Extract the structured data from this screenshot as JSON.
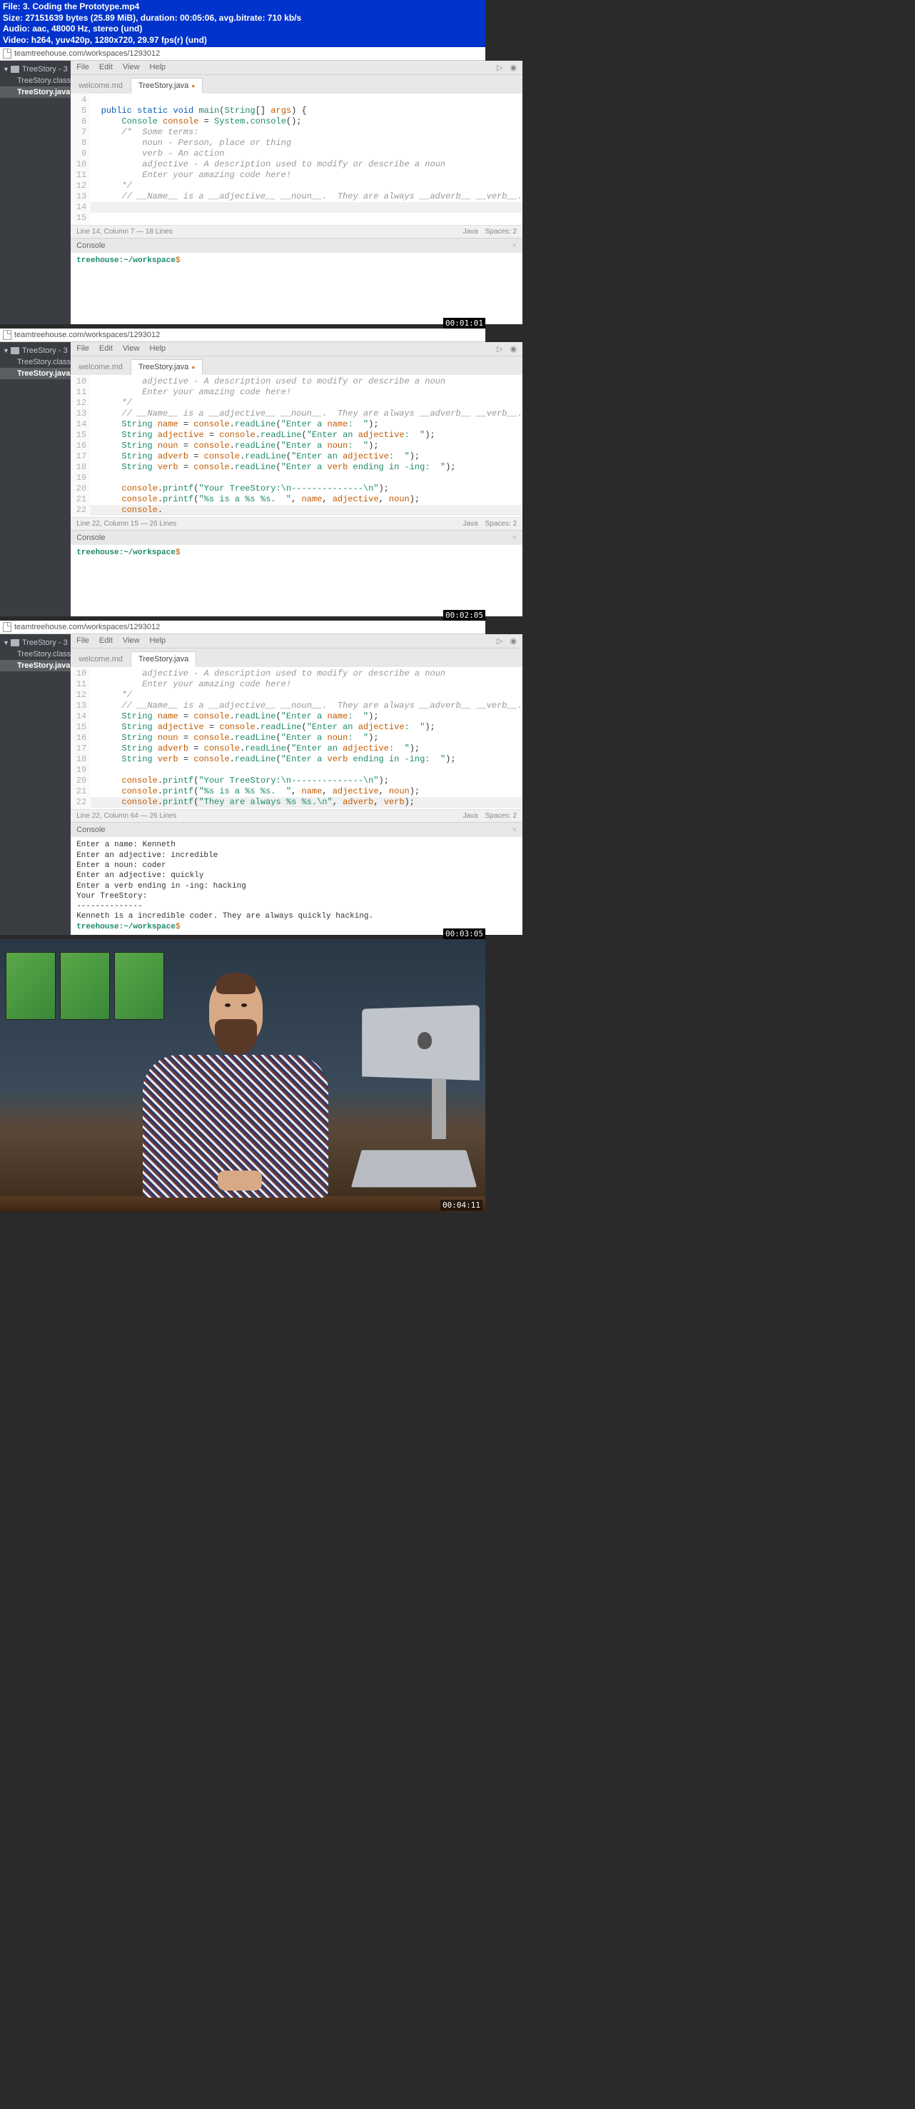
{
  "header": {
    "line1": "File: 3. Coding the Prototype.mp4",
    "line2": "Size: 27151639 bytes (25.89 MiB), duration: 00:05:06, avg.bitrate: 710 kb/s",
    "line3": "Audio: aac, 48000 Hz, stereo (und)",
    "line4": "Video: h264, yuv420p, 1280x720, 29.97 fps(r) (und)"
  },
  "url": "teamtreehouse.com/workspaces/1293012",
  "sidebar": {
    "project": "TreeStory - 3",
    "items": [
      "TreeStory.class",
      "TreeStory.java"
    ],
    "active": "TreeStory.java"
  },
  "menu": {
    "items": [
      "File",
      "Edit",
      "View",
      "Help"
    ]
  },
  "tabs": {
    "inactive": "welcome.md",
    "active": "TreeStory.java"
  },
  "status": {
    "lang": "Java",
    "spaces": "Spaces: 2"
  },
  "console": {
    "title": "Console",
    "prompt_host": "treehouse:~/workspace",
    "prompt_sym": "$"
  },
  "block1": {
    "gutter": [
      "4",
      "5",
      "6",
      "7",
      "8",
      "9",
      "10",
      "11",
      "12",
      "13",
      "14",
      "15"
    ],
    "code": [
      "",
      "  public static void main(String[] args) {",
      "      Console console = System.console();",
      "      /*  Some terms:",
      "          noun - Person, place or thing",
      "          verb - An action",
      "          adjective - A description used to modify or describe a noun",
      "          Enter your amazing code here!",
      "      */",
      "      // __Name__ is a __adjective__ __noun__.  They are always __adverb__ __verb__.",
      "      ",
      ""
    ],
    "status": "Line 14, Column 7 — 18 Lines",
    "timestamp": "00:01:01"
  },
  "block2": {
    "gutter": [
      "10",
      "11",
      "12",
      "13",
      "14",
      "15",
      "16",
      "17",
      "18",
      "19",
      "20",
      "21",
      "22"
    ],
    "code_raw": [
      "          adjective - A description used to modify or describe a noun",
      "          Enter your amazing code here!",
      "      */",
      "      // __Name__ is a __adjective__ __noun__.  They are always __adverb__ __verb__.",
      "      String name = console.readLine(\"Enter a name:  \");",
      "      String adjective = console.readLine(\"Enter an adjective:  \");",
      "      String noun = console.readLine(\"Enter a noun:  \");",
      "      String adverb = console.readLine(\"Enter an adjective:  \");",
      "      String verb = console.readLine(\"Enter a verb ending in -ing:  \");",
      "",
      "      console.printf(\"Your TreeStory:\\n--------------\\n\");",
      "      console.printf(\"%s is a %s %s.  \", name, adjective, noun);",
      "      console."
    ],
    "status": "Line 22, Column 15 — 26 Lines",
    "timestamp": "00:02:05"
  },
  "block3": {
    "gutter": [
      "10",
      "11",
      "12",
      "13",
      "14",
      "15",
      "16",
      "17",
      "18",
      "19",
      "20",
      "21",
      "22"
    ],
    "code_raw": [
      "          adjective - A description used to modify or describe a noun",
      "          Enter your amazing code here!",
      "      */",
      "      // __Name__ is a __adjective__ __noun__.  They are always __adverb__ __verb__.",
      "      String name = console.readLine(\"Enter a name:  \");",
      "      String adjective = console.readLine(\"Enter an adjective:  \");",
      "      String noun = console.readLine(\"Enter a noun:  \");",
      "      String adverb = console.readLine(\"Enter an adjective:  \");",
      "      String verb = console.readLine(\"Enter a verb ending in -ing:  \");",
      "",
      "      console.printf(\"Your TreeStory:\\n--------------\\n\");",
      "      console.printf(\"%s is a %s %s.  \", name, adjective, noun);",
      "      console.printf(\"They are always %s %s.\\n\", adverb, verb);"
    ],
    "status": "Line 22, Column 64 — 26 Lines",
    "tab_clean": true,
    "console_output": [
      "Enter a name:  Kenneth",
      "Enter an adjective:  incredible",
      "Enter a noun:  coder",
      "Enter an adjective:  quickly",
      "Enter a verb ending in -ing:  hacking",
      "Your TreeStory:",
      "--------------",
      "Kenneth is a incredible coder.  They are always quickly hacking."
    ],
    "timestamp": "00:03:05"
  },
  "video_timestamp": "00:04:11"
}
